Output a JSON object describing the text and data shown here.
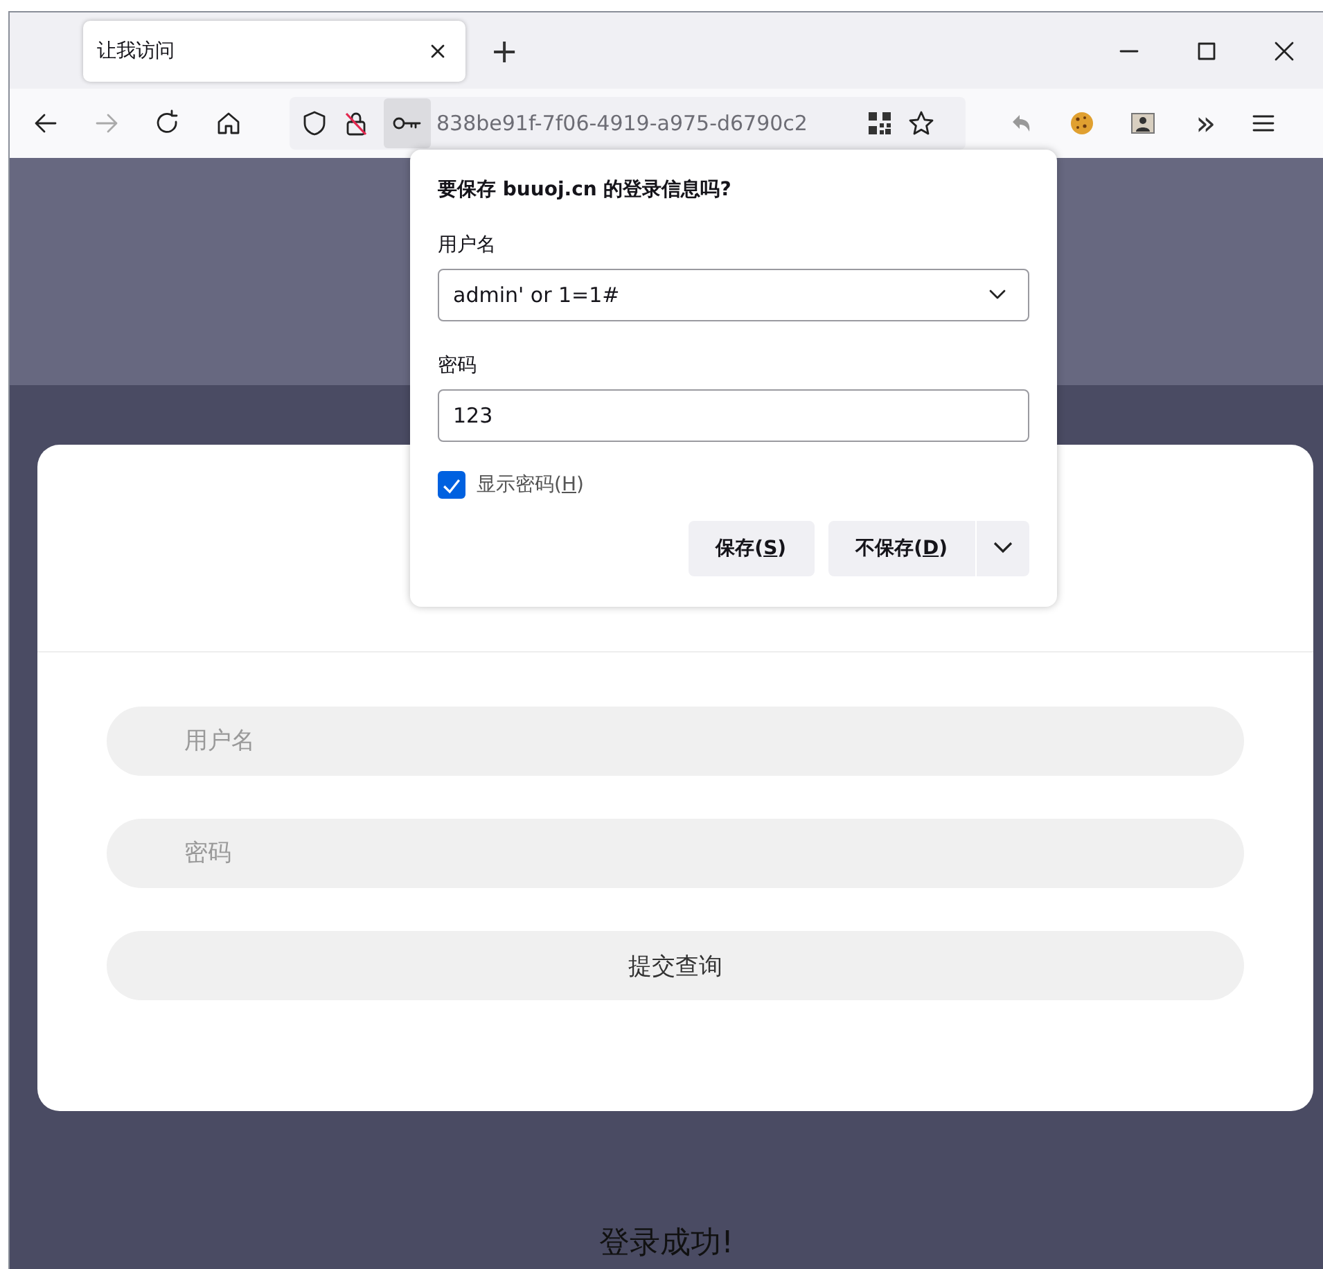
{
  "window": {
    "tabs": [
      {
        "title": "让我访问",
        "selected": true
      }
    ],
    "new_tab": "+"
  },
  "toolbar": {
    "forward_disabled": true,
    "url": "838be91f-7f06-4919-a975-d6790c2",
    "overflow": "»"
  },
  "save_login_popup": {
    "heading_parts": [
      "要保存 ",
      "buuoj.cn",
      " 的登录信息吗?"
    ],
    "username_label": "用户名",
    "username_value": "admin' or 1=1#",
    "password_label": "密码",
    "password_value": "123",
    "show_password": {
      "before": "显示密码(",
      "key": "H",
      "after": ")",
      "checked": true
    },
    "buttons": [
      {
        "before": "保存(",
        "key": "S",
        "after": ")"
      },
      {
        "before": "不保存(",
        "key": "D",
        "after": ")"
      }
    ]
  },
  "page": {
    "username_placeholder": "用户名",
    "password_placeholder": "密码",
    "submit": "提交查询",
    "message": "登录成功!"
  }
}
